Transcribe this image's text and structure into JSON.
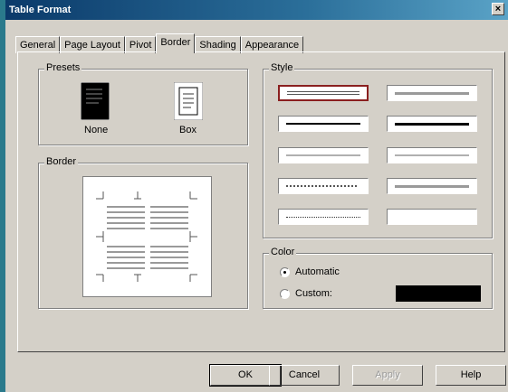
{
  "window": {
    "title": "Table Format",
    "close_glyph": "×"
  },
  "tabs": [
    "General",
    "Page Layout",
    "Pivot",
    "Border",
    "Shading",
    "Appearance"
  ],
  "active_tab": "Border",
  "presets": {
    "label": "Presets",
    "none_label": "None",
    "box_label": "Box"
  },
  "border": {
    "label": "Border"
  },
  "style": {
    "label": "Style",
    "selected": "double",
    "lines": [
      "double",
      "solid",
      "medium",
      "thick",
      "thin",
      "light",
      "dotted",
      "medium-gray",
      "fine-dotted",
      "none"
    ]
  },
  "color": {
    "label": "Color",
    "automatic_label": "Automatic",
    "custom_label": "Custom:",
    "selected": "automatic",
    "swatch_color": "#000000"
  },
  "buttons": {
    "ok": "OK",
    "cancel": "Cancel",
    "apply": "Apply",
    "help": "Help"
  },
  "colors": {
    "dialog_bg": "#d4d0c8",
    "title_start": "#0b3a6a",
    "title_end": "#5aa3c7",
    "selection": "#8a1f1f"
  }
}
